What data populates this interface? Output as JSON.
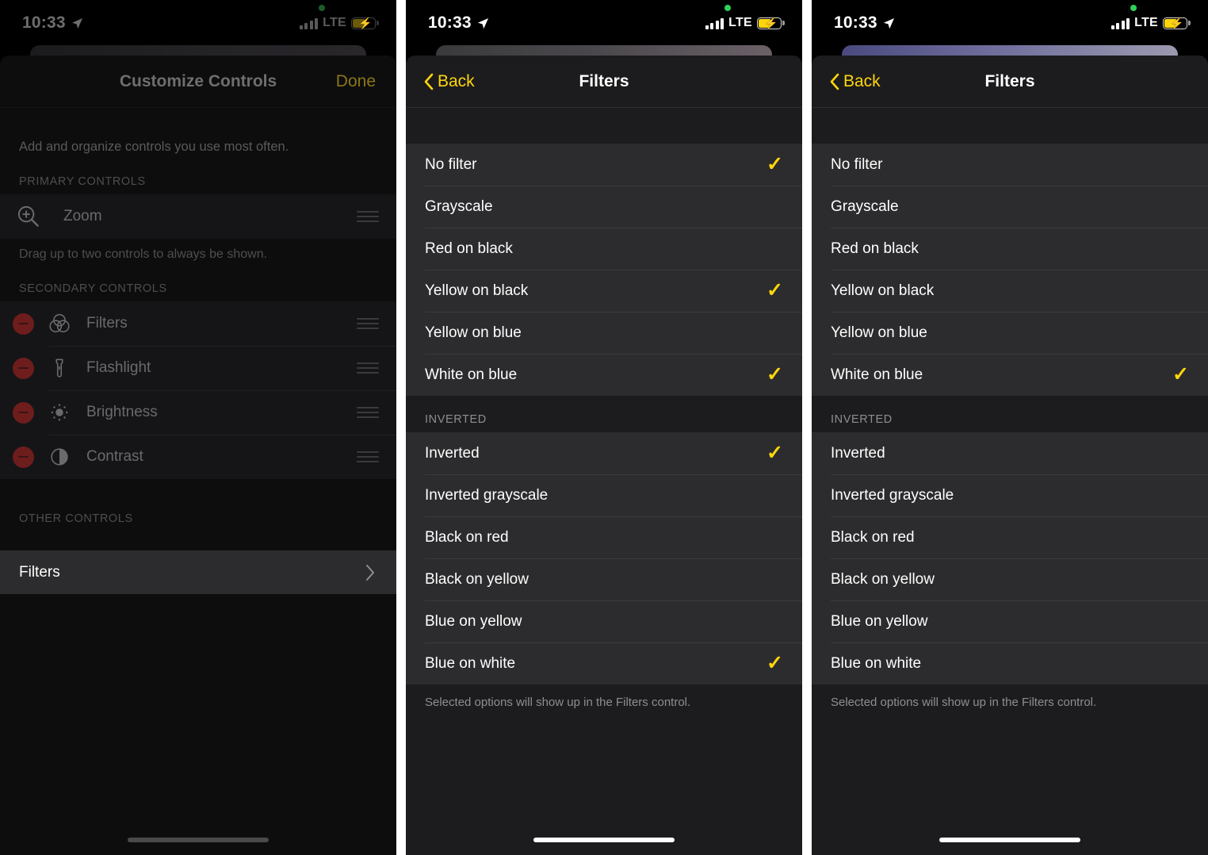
{
  "status_bar": {
    "time": "10:33",
    "carrier": "LTE",
    "location_icon": "location-arrow-icon",
    "recording_dot": "green-recording-dot",
    "signal_icon": "cellular-signal-icon",
    "battery_icon": "battery-charging-icon",
    "battery_color": "#ffd60a"
  },
  "accent_color": "#ffd60a",
  "panels": [
    {
      "id": "customize-controls",
      "nav": {
        "title": "Customize Controls",
        "done_label": "Done"
      },
      "intro": "Add and organize controls you use most often.",
      "primary_header": "PRIMARY CONTROLS",
      "primary_items": [
        {
          "label": "Zoom",
          "icon": "zoom-in-magnifier-icon"
        }
      ],
      "primary_hint": "Drag up to two controls to always be shown.",
      "secondary_header": "SECONDARY CONTROLS",
      "secondary_items": [
        {
          "label": "Filters",
          "icon": "color-filters-circles-icon"
        },
        {
          "label": "Flashlight",
          "icon": "flashlight-icon"
        },
        {
          "label": "Brightness",
          "icon": "brightness-sun-icon"
        },
        {
          "label": "Contrast",
          "icon": "contrast-half-circle-icon"
        }
      ],
      "other_header": "OTHER CONTROLS",
      "other_items": [
        {
          "label": "Filters",
          "accessory": "chevron-right-icon"
        }
      ]
    },
    {
      "id": "filters-multi-selected",
      "nav": {
        "back_label": "Back",
        "title": "Filters"
      },
      "groups": [
        {
          "header": "",
          "items": [
            {
              "label": "No filter",
              "checked": true
            },
            {
              "label": "Grayscale",
              "checked": false
            },
            {
              "label": "Red on black",
              "checked": false
            },
            {
              "label": "Yellow on black",
              "checked": true
            },
            {
              "label": "Yellow on blue",
              "checked": false
            },
            {
              "label": "White on blue",
              "checked": true
            }
          ]
        },
        {
          "header": "INVERTED",
          "items": [
            {
              "label": "Inverted",
              "checked": true
            },
            {
              "label": "Inverted grayscale",
              "checked": false
            },
            {
              "label": "Black on red",
              "checked": false
            },
            {
              "label": "Black on yellow",
              "checked": false
            },
            {
              "label": "Blue on yellow",
              "checked": false
            },
            {
              "label": "Blue on white",
              "checked": true
            }
          ]
        }
      ],
      "footnote": "Selected options will show up in the Filters control."
    },
    {
      "id": "filters-single-selected",
      "nav": {
        "back_label": "Back",
        "title": "Filters"
      },
      "groups": [
        {
          "header": "",
          "items": [
            {
              "label": "No filter",
              "checked": false
            },
            {
              "label": "Grayscale",
              "checked": false
            },
            {
              "label": "Red on black",
              "checked": false
            },
            {
              "label": "Yellow on black",
              "checked": false
            },
            {
              "label": "Yellow on blue",
              "checked": false
            },
            {
              "label": "White on blue",
              "checked": true
            }
          ]
        },
        {
          "header": "INVERTED",
          "items": [
            {
              "label": "Inverted",
              "checked": false
            },
            {
              "label": "Inverted grayscale",
              "checked": false
            },
            {
              "label": "Black on red",
              "checked": false
            },
            {
              "label": "Black on yellow",
              "checked": false
            },
            {
              "label": "Blue on yellow",
              "checked": false
            },
            {
              "label": "Blue on white",
              "checked": false
            }
          ]
        }
      ],
      "footnote": "Selected options will show up in the Filters control."
    }
  ],
  "check_glyph": "✓"
}
